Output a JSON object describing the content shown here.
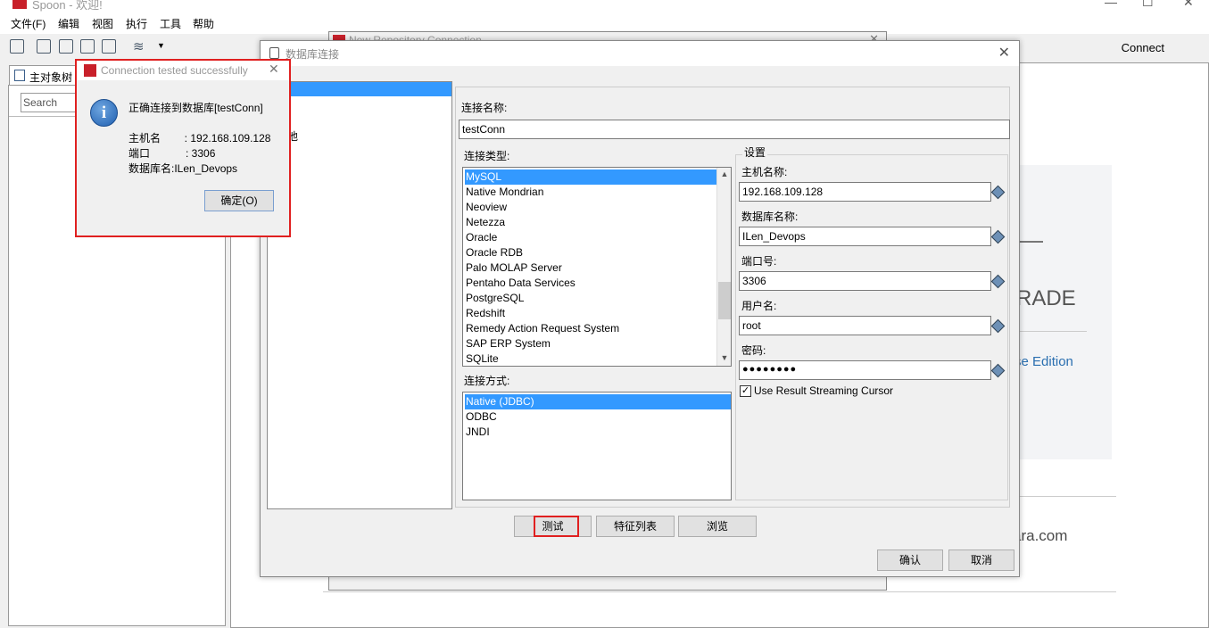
{
  "app": {
    "title": "Spoon - 欢迎!"
  },
  "menu": [
    "文件(F)",
    "编辑",
    "视图",
    "执行",
    "工具",
    "帮助"
  ],
  "toolbar": {
    "connect": "Connect"
  },
  "left_panel": {
    "tab_label": "主对象树",
    "search_placeholder": "Search"
  },
  "background": {
    "bg_dialog_title": "New Repository Connection",
    "welcome_upgrade": "RADE",
    "welcome_edition": "se Edition",
    "welcome_site": "ara.com"
  },
  "db_dialog": {
    "title": "数据库连接",
    "left_list_partial": "池",
    "conn_name_label": "连接名称:",
    "conn_name_value": "testConn",
    "conn_type_label": "连接类型:",
    "conn_types": [
      "MySQL",
      "Native Mondrian",
      "Neoview",
      "Netezza",
      "Oracle",
      "Oracle RDB",
      "Palo MOLAP Server",
      "Pentaho Data Services",
      "PostgreSQL",
      "Redshift",
      "Remedy Action Request System",
      "SAP ERP System",
      "SQLite"
    ],
    "conn_type_selected": "MySQL",
    "access_label": "连接方式:",
    "access_types": [
      "Native (JDBC)",
      "ODBC",
      "JNDI"
    ],
    "access_selected": "Native (JDBC)",
    "settings_label": "设置",
    "host_label": "主机名称:",
    "host_value": "192.168.109.128",
    "dbname_label": "数据库名称:",
    "dbname_value": "ILen_Devops",
    "port_label": "端口号:",
    "port_value": "3306",
    "user_label": "用户名:",
    "user_value": "root",
    "password_label": "密码:",
    "password_value": "●●●●●●●●",
    "streaming_label": "Use Result Streaming Cursor",
    "streaming_checked": true,
    "test_button": "测试",
    "features_button": "特征列表",
    "explore_button": "浏览",
    "ok_button": "确认",
    "cancel_button": "取消"
  },
  "popup": {
    "title": "Connection tested successfully",
    "message": "正确连接到数据库[testConn]",
    "host_line": "主机名        : 192.168.109.128",
    "port_line": "端口            : 3306",
    "db_line": "数据库名:ILen_Devops",
    "ok_button": "确定(O)"
  }
}
